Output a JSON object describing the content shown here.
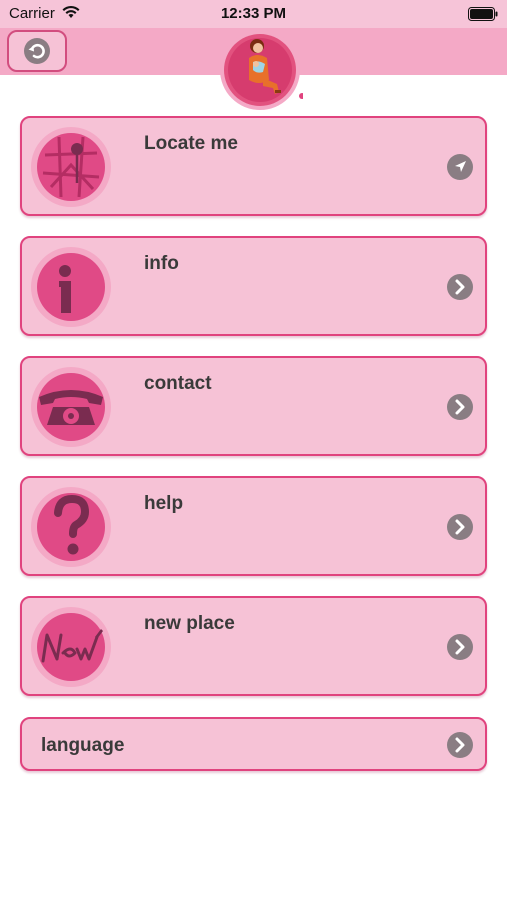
{
  "status_bar": {
    "carrier": "Carrier",
    "time": "12:33 PM"
  },
  "nav": {
    "back_icon": "undo-arrow-icon",
    "logo": "mother-baby-logo"
  },
  "menu": [
    {
      "label": "Locate me",
      "icon": "city-map-pin-icon",
      "action_icon": "location-arrow-icon"
    },
    {
      "label": "info",
      "icon": "info-i-icon",
      "action_icon": "chevron-right-icon"
    },
    {
      "label": "contact",
      "icon": "rotary-phone-icon",
      "action_icon": "chevron-right-icon"
    },
    {
      "label": "help",
      "icon": "question-mark-icon",
      "action_icon": "chevron-right-icon"
    },
    {
      "label": "new place",
      "icon": "new-handwriting-icon",
      "action_icon": "chevron-right-icon"
    }
  ],
  "language": {
    "label": "language",
    "action_icon": "chevron-right-icon"
  },
  "colors": {
    "status_bar_bg": "#f6c4d8",
    "nav_bar_bg": "#f4a9c6",
    "card_bg": "#f6c2d6",
    "card_border": "#e0437e",
    "icon_pink": "#e04a86",
    "chevron_grey": "#8a7d83"
  }
}
